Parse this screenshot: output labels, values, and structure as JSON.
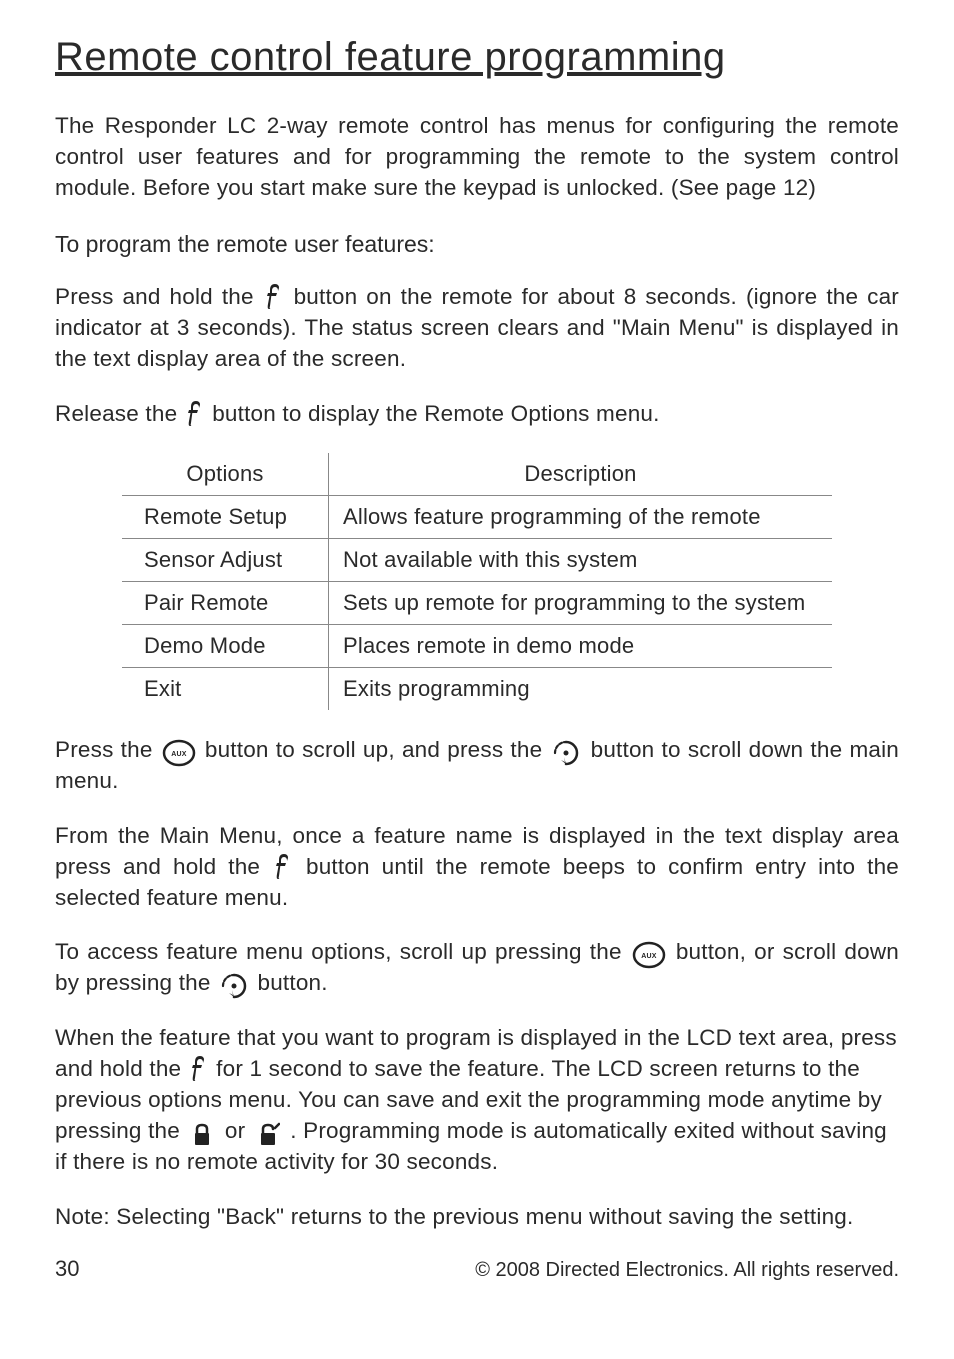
{
  "title": "Remote control feature programming",
  "intro": "The Responder LC 2-way remote control has menus for configuring the remote control user features and for programming the remote to the system control module. Before you start make sure the keypad is unlocked. (See page 12)",
  "subhead": "To program the remote user features:",
  "p1a": "Press and hold the ",
  "p1b": " button on the remote for about 8 seconds. (ignore the car indicator at 3 seconds). The status screen clears and \"Main Menu\" is displayed in the text display area of the screen.",
  "p2a": "Release the ",
  "p2b": " button to display the Remote Options menu.",
  "table": {
    "headers": [
      "Options",
      "Description"
    ],
    "rows": [
      [
        "Remote Setup",
        "Allows feature programming of the remote"
      ],
      [
        "Sensor Adjust",
        "Not available with this system"
      ],
      [
        "Pair Remote",
        "Sets up remote for programming to the system"
      ],
      [
        "Demo Mode",
        "Places remote in demo mode"
      ],
      [
        "Exit",
        "Exits programming"
      ]
    ]
  },
  "p3a": "Press the ",
  "p3b": " button to scroll up, and press the ",
  "p3c": " button to scroll down the main menu.",
  "p4a": "From the Main Menu, once a feature name is displayed in the text display area press and hold the ",
  "p4b": " button until the remote beeps to confirm entry into the selected feature menu.",
  "p5a": "To access feature menu options, scroll up pressing the ",
  "p5b": " button, or scroll down by pressing the ",
  "p5c": " button.",
  "p6a": "When the feature that you want to program is displayed in the LCD text area, press and hold the ",
  "p6b": " for 1 second to save the feature. The LCD screen returns to the previous options menu. You can save and exit the programming mode anytime by pressing the ",
  "p6c": " or ",
  "p6d": ".  Programming mode is automatically exited without saving if there is no remote activity for 30 seconds.",
  "note_label": "Note:",
  "note": " Selecting \"Back\" returns to the previous menu without saving the setting.",
  "page_num": "30",
  "copyright": "© 2008 Directed Electronics. All rights reserved."
}
